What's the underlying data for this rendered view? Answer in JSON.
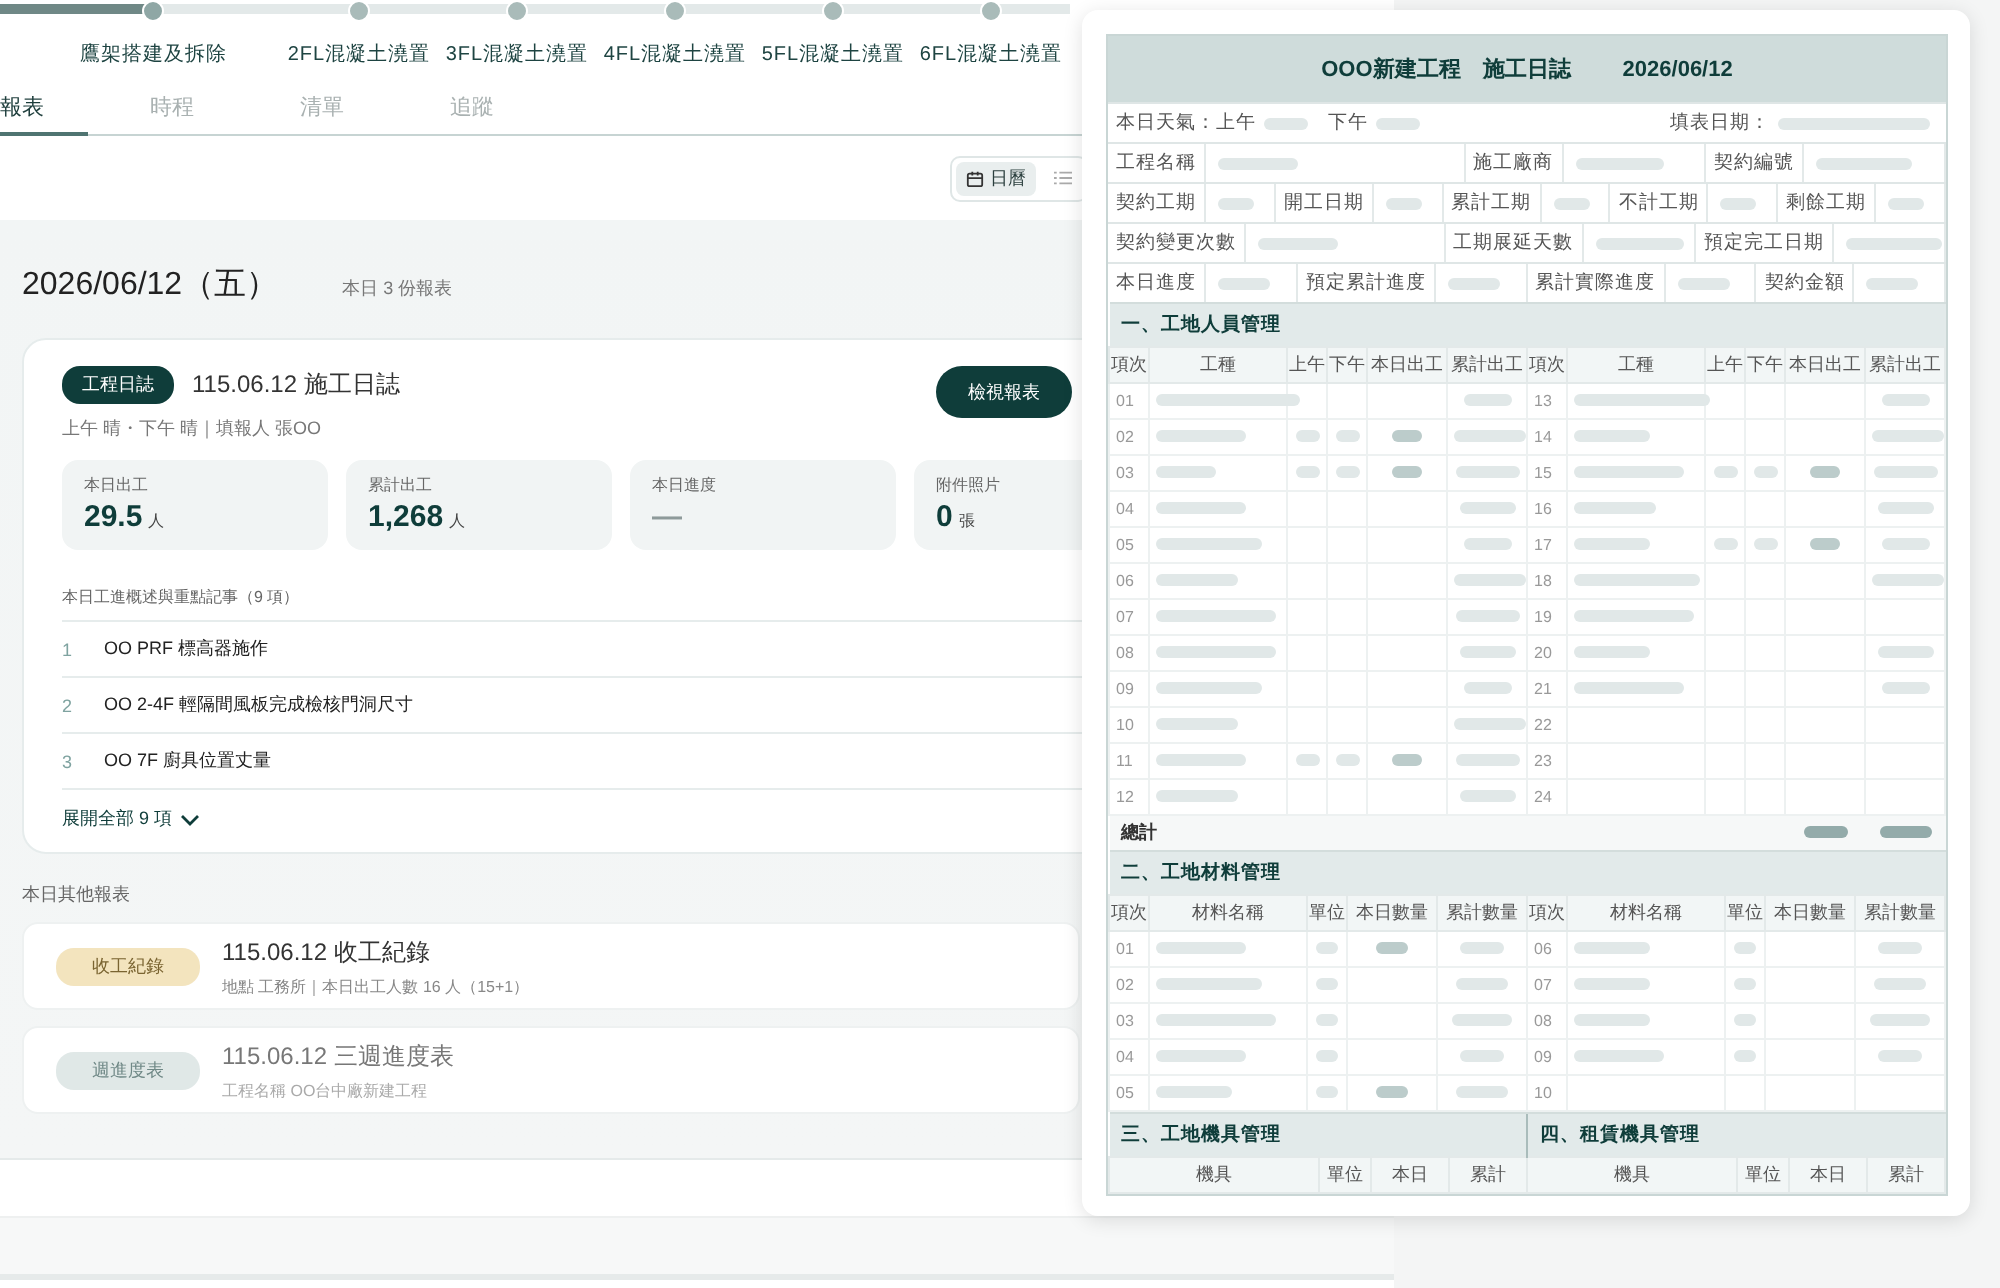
{
  "stepper": {
    "steps": [
      {
        "label": "鷹架搭建及拆除",
        "done": true
      },
      {
        "label": "2FL混凝土澆置",
        "done": false
      },
      {
        "label": "3FL混凝土澆置",
        "done": false
      },
      {
        "label": "4FL混凝土澆置",
        "done": false
      },
      {
        "label": "5FL混凝土澆置",
        "done": false
      },
      {
        "label": "6FL混凝土澆置",
        "done": false
      }
    ]
  },
  "tabs": [
    {
      "label": "報表",
      "selected": true
    },
    {
      "label": "時程",
      "selected": false
    },
    {
      "label": "清單",
      "selected": false
    },
    {
      "label": "追蹤",
      "selected": false
    }
  ],
  "view_options": [
    {
      "label": "日曆",
      "selected": true
    },
    {
      "selected": false
    }
  ],
  "day": {
    "date": "2026/06/12（五）",
    "count": "本日 3 份報表"
  },
  "main_report": {
    "badge": "工程日誌",
    "title": "115.06.12 施工日誌",
    "meta": "上午 晴・下午 晴｜填報人 張OO",
    "button": "檢視報表",
    "stats": [
      {
        "label": "本日出工",
        "value": "29.5",
        "unit": "人",
        "empty": false
      },
      {
        "label": "累計出工",
        "value": "1,268",
        "unit": "人",
        "empty": false
      },
      {
        "label": "本日進度",
        "value": "—",
        "empty": true
      },
      {
        "label": "附件照片",
        "value": "0",
        "unit": "張",
        "empty": false
      }
    ],
    "notes_heading": "本日工進概述與重點記事（9 項）",
    "notes": [
      {
        "no": "1",
        "text": "OO PRF 標高器施作"
      },
      {
        "no": "2",
        "text": "OO 2-4F 輕隔間風板完成檢核門洞尺寸"
      },
      {
        "no": "3",
        "text": "OO 7F 廚具位置丈量"
      }
    ],
    "expand": "展開全部 9 項"
  },
  "other_heading": "本日其他報表",
  "other_reports": [
    {
      "badge": "收工紀錄",
      "color": "#f3e4be",
      "title": "115.06.12 收工紀錄",
      "detail": "地點 工務所｜本日出工人數 16 人（15+1）",
      "muted": false
    },
    {
      "badge": "週進度表",
      "color": "#e0e8e7",
      "title": "115.06.12 三週進度表",
      "detail": "工程名稱 OO台中廠新建工程",
      "muted": true
    }
  ],
  "form": {
    "title": "OOO新建工程　施工日誌",
    "date": "2026/06/12",
    "weather": {
      "am_label": "本日天氣：上午",
      "pm_label": "下午",
      "date_label": "填表日期："
    },
    "field_rows": [
      [
        "工程名稱",
        "施工廠商",
        "契約編號"
      ],
      [
        "契約工期",
        "開工日期",
        "累計工期",
        "不計工期",
        "剩餘工期"
      ],
      [
        "契約變更次數",
        "工期展延天數",
        "預定完工日期"
      ],
      [
        "本日進度",
        "預定累計進度",
        "累計實際進度",
        "契約金額"
      ]
    ],
    "personnel": {
      "heading": "一、工地人員管理",
      "columns_left": [
        "項次",
        "工種",
        "上午",
        "下午",
        "本日出工",
        "累計出工"
      ],
      "columns_right": [
        "項次",
        "工種",
        "上午",
        "下午",
        "本日出工",
        "累計出工"
      ],
      "left": [
        {
          "no": "01",
          "entered": true,
          "today": false,
          "total": true
        },
        {
          "no": "02",
          "entered": true,
          "today": true,
          "total": true
        },
        {
          "no": "03",
          "entered": true,
          "today": true,
          "total": true
        },
        {
          "no": "04",
          "entered": true,
          "today": false,
          "total": true
        },
        {
          "no": "05",
          "entered": true,
          "today": false,
          "total": true
        },
        {
          "no": "06",
          "entered": true,
          "today": false,
          "total": true
        },
        {
          "no": "07",
          "entered": true,
          "today": false,
          "total": true
        },
        {
          "no": "08",
          "entered": true,
          "today": false,
          "total": true
        },
        {
          "no": "09",
          "entered": true,
          "today": false,
          "total": true
        },
        {
          "no": "10",
          "entered": true,
          "today": false,
          "total": true
        },
        {
          "no": "11",
          "entered": true,
          "today": true,
          "total": true
        },
        {
          "no": "12",
          "entered": true,
          "today": false,
          "total": true
        }
      ],
      "right": [
        {
          "no": "13",
          "entered": true,
          "today": false,
          "total": true
        },
        {
          "no": "14",
          "entered": true,
          "today": false,
          "total": true
        },
        {
          "no": "15",
          "entered": true,
          "today": true,
          "total": true
        },
        {
          "no": "16",
          "entered": true,
          "today": false,
          "total": true
        },
        {
          "no": "17",
          "entered": true,
          "today": true,
          "total": true
        },
        {
          "no": "18",
          "entered": true,
          "today": false,
          "total": true
        },
        {
          "no": "19",
          "entered": true,
          "today": false,
          "total": false
        },
        {
          "no": "20",
          "entered": true,
          "today": false,
          "total": true
        },
        {
          "no": "21",
          "entered": true,
          "today": false,
          "total": true
        },
        {
          "no": "22",
          "entered": false,
          "today": false,
          "total": false
        },
        {
          "no": "23",
          "entered": false,
          "today": false,
          "total": false
        },
        {
          "no": "24",
          "entered": false,
          "today": false,
          "total": false
        }
      ],
      "total": {
        "label": "總計",
        "filled": true
      }
    },
    "materials": {
      "heading": "二、工地材料管理",
      "columns_left": [
        "項次",
        "材料名稱",
        "單位",
        "本日數量",
        "累計數量"
      ],
      "columns_right": [
        "項次",
        "材料名稱",
        "單位",
        "本日數量",
        "累計數量"
      ],
      "left": [
        {
          "no": "01",
          "entered": true,
          "today": true
        },
        {
          "no": "02",
          "entered": true,
          "today": false
        },
        {
          "no": "03",
          "entered": true,
          "today": false
        },
        {
          "no": "04",
          "entered": true,
          "today": false
        },
        {
          "no": "05",
          "entered": true,
          "today": true
        }
      ],
      "right": [
        {
          "no": "06",
          "entered": true,
          "today": false
        },
        {
          "no": "07",
          "entered": true,
          "today": false
        },
        {
          "no": "08",
          "entered": true,
          "today": false
        },
        {
          "no": "09",
          "entered": true,
          "today": false
        },
        {
          "no": "10",
          "entered": false,
          "today": false
        }
      ]
    },
    "equipment": {
      "heading": "三、工地機具管理",
      "columns": [
        "機具",
        "單位",
        "本日",
        "累計"
      ]
    },
    "rental": {
      "heading": "四、租賃機具管理",
      "columns": [
        "機具",
        "單位",
        "本日",
        "累計"
      ]
    }
  }
}
